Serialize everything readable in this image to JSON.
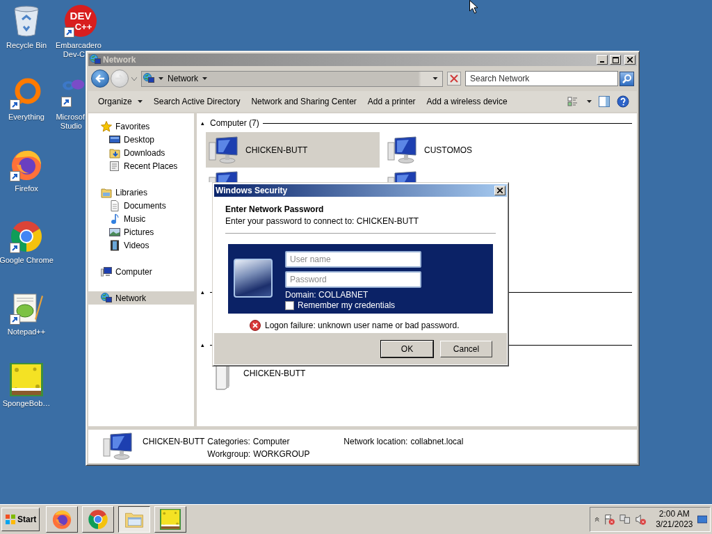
{
  "desktop": {
    "icons": [
      {
        "kind": "recycle",
        "label": [
          "Recycle Bin"
        ],
        "shortcut": false
      },
      {
        "kind": "devcpp",
        "logo": [
          "DEV",
          "C++"
        ],
        "label": [
          "Embarcadero",
          "Dev-C"
        ],
        "shortcut": true
      },
      {
        "kind": "everything",
        "label": [
          "Everything"
        ],
        "shortcut": true
      },
      {
        "kind": "vstudio",
        "label": [
          "Microsof",
          "Studio"
        ],
        "shortcut": true
      },
      {
        "kind": "firefox",
        "label": [
          "Firefox"
        ],
        "shortcut": true
      },
      {
        "kind": "chrome",
        "label": [
          "Google Chrome"
        ],
        "shortcut": true
      },
      {
        "kind": "notepad",
        "label": [
          "Notepad++"
        ],
        "shortcut": true
      },
      {
        "kind": "picture",
        "label": [
          "SpongeBob…"
        ],
        "shortcut": false
      }
    ]
  },
  "explorer": {
    "title": "Network",
    "address": [
      "Network"
    ],
    "search": {
      "placeholder": "Search Network"
    },
    "commands": [
      {
        "label": "Organize",
        "menu": true
      },
      {
        "label": "Search Active Directory",
        "menu": false
      },
      {
        "label": "Network and Sharing Center",
        "menu": false
      },
      {
        "label": "Add a printer",
        "menu": false
      },
      {
        "label": "Add a wireless device",
        "menu": false
      }
    ],
    "nav": [
      {
        "label": "Favorites",
        "kind": "star",
        "selected": false,
        "children": [
          {
            "label": "Desktop",
            "kind": "desktop",
            "selected": false
          },
          {
            "label": "Downloads",
            "kind": "downloads",
            "selected": false
          },
          {
            "label": "Recent Places",
            "kind": "recent",
            "selected": false
          }
        ]
      },
      {
        "label": "Libraries",
        "kind": "library",
        "selected": false,
        "children": [
          {
            "label": "Documents",
            "kind": "document",
            "selected": false
          },
          {
            "label": "Music",
            "kind": "music",
            "selected": false
          },
          {
            "label": "Pictures",
            "kind": "pictures",
            "selected": false
          },
          {
            "label": "Videos",
            "kind": "videos",
            "selected": false
          }
        ]
      },
      {
        "label": "Computer",
        "kind": "computer",
        "selected": false
      },
      {
        "label": "Network",
        "kind": "network",
        "selected": true
      }
    ],
    "groups": [
      {
        "toggle": "▴",
        "title": "Computer (7)",
        "items": [
          {
            "name": "CHICKEN-BUTT",
            "kind": "computer",
            "selected": true
          },
          {
            "name": "CUSTOMOS",
            "kind": "computer",
            "selected": false
          },
          {
            "kind": "computer",
            "selected": false
          },
          {
            "kind": "computer",
            "selected": false
          }
        ]
      },
      {
        "toggle": "▴"
      },
      {
        "toggle": "▴",
        "items": [
          {
            "name": "CHICKEN-BUTT",
            "kind": "tower",
            "selected": false
          }
        ]
      }
    ],
    "details": {
      "name": "CHICKEN-BUTT",
      "fields": [
        {
          "label": "Categories:",
          "value": "Computer"
        },
        {
          "label": "Workgroup:",
          "value": "WORKGROUP"
        },
        {
          "label": "Network location:",
          "value": "collabnet.local"
        }
      ]
    }
  },
  "dialog": {
    "title": "Windows Security",
    "heading": "Enter Network Password",
    "subtitle": "Enter your password to connect to: CHICKEN-BUTT",
    "username": {
      "placeholder": "User name"
    },
    "password": {
      "placeholder": "Password"
    },
    "domain": "Domain: COLLABNET",
    "remember": {
      "label": "Remember my credentials",
      "checked": false
    },
    "error": "Logon failure: unknown user name or bad password.",
    "buttons": [
      {
        "label": "OK",
        "default": true
      },
      {
        "label": "Cancel",
        "default": false
      }
    ]
  },
  "taskbar": {
    "start": "Start",
    "apps": [
      {
        "kind": "firefox",
        "selected": false
      },
      {
        "kind": "chrome",
        "selected": false
      },
      {
        "kind": "explorer",
        "selected": true
      },
      {
        "kind": "picture",
        "selected": false
      }
    ],
    "clock": {
      "time": "2:00 AM",
      "date": "3/21/2023"
    }
  }
}
